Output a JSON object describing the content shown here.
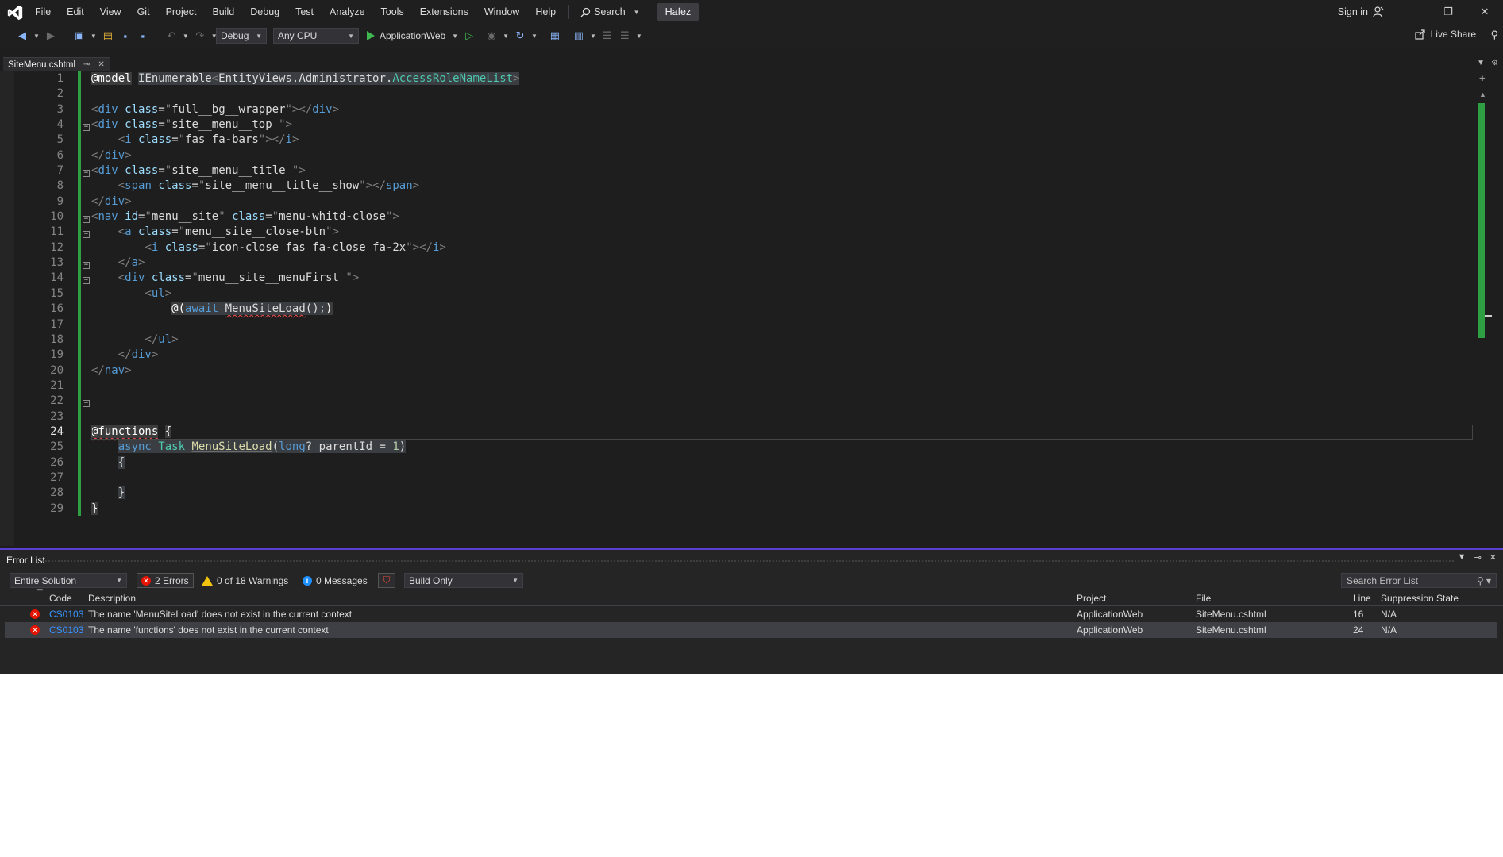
{
  "menubar": {
    "items": [
      "File",
      "Edit",
      "View",
      "Git",
      "Project",
      "Build",
      "Debug",
      "Test",
      "Analyze",
      "Tools",
      "Extensions",
      "Window",
      "Help"
    ],
    "search_label": "Search",
    "solution_name": "Hafez",
    "signin_label": "Sign in"
  },
  "toolbar": {
    "config": "Debug",
    "platform": "Any CPU",
    "startup_project": "ApplicationWeb",
    "liveshare_label": "Live Share"
  },
  "tab": {
    "filename": "SiteMenu.cshtml"
  },
  "editor": {
    "current_line": 24,
    "line_numbers": [
      "1",
      "2",
      "3",
      "4",
      "5",
      "6",
      "7",
      "8",
      "9",
      "10",
      "11",
      "12",
      "13",
      "14",
      "15",
      "16",
      "17",
      "18",
      "19",
      "20",
      "21",
      "22",
      "23",
      "24",
      "25",
      "26",
      "27",
      "28",
      "29"
    ]
  },
  "error_list": {
    "title": "Error List",
    "scope": "Entire Solution",
    "errors_label": "2 Errors",
    "warnings_label": "0 of 18 Warnings",
    "messages_label": "0 Messages",
    "build_filter": "Build Only",
    "search_placeholder": "Search Error List",
    "columns": {
      "code": "Code",
      "description": "Description",
      "project": "Project",
      "file": "File",
      "line": "Line",
      "suppression": "Suppression State"
    },
    "rows": [
      {
        "code": "CS0103",
        "description": "The name 'MenuSiteLoad' does not exist in the current context",
        "project": "ApplicationWeb",
        "file": "SiteMenu.cshtml",
        "line": "16",
        "suppression": "N/A"
      },
      {
        "code": "CS0103",
        "description": "The name 'functions' does not exist in the current context",
        "project": "ApplicationWeb",
        "file": "SiteMenu.cshtml",
        "line": "24",
        "suppression": "N/A"
      }
    ]
  }
}
